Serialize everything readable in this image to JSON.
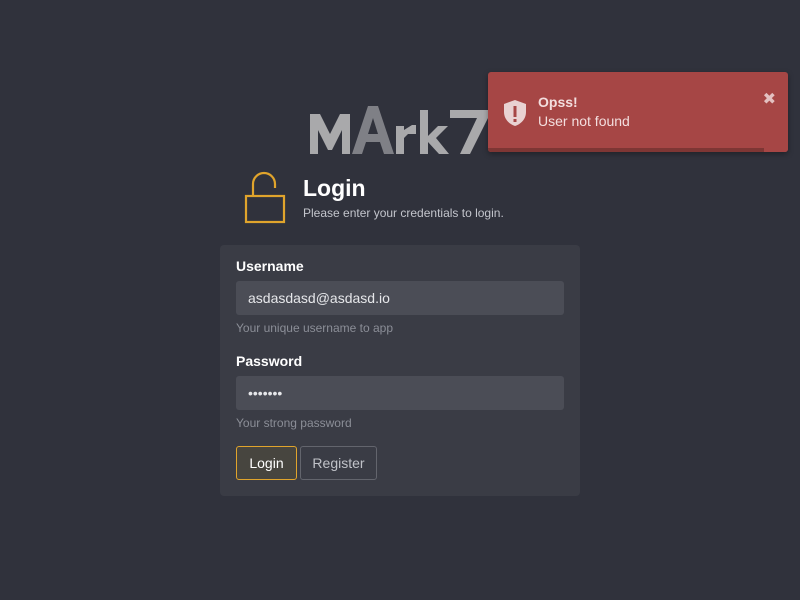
{
  "logo": {
    "text": "MArk7"
  },
  "header": {
    "title": "Login",
    "subtitle": "Please enter your credentials to login."
  },
  "form": {
    "username": {
      "label": "Username",
      "value": "asdasdasd@asdasd.io",
      "help": "Your unique username to app"
    },
    "password": {
      "label": "Password",
      "value": "•••••••",
      "help": "Your strong password"
    },
    "buttons": {
      "login": "Login",
      "register": "Register"
    }
  },
  "toast": {
    "title": "Opss!",
    "message": "User not found",
    "close": "✖",
    "progress": 0.92,
    "icon": "shield-alert-icon"
  },
  "colors": {
    "background": "#30323c",
    "card": "#3a3c45",
    "accent": "#e0a42c",
    "toast": "#a64645"
  }
}
